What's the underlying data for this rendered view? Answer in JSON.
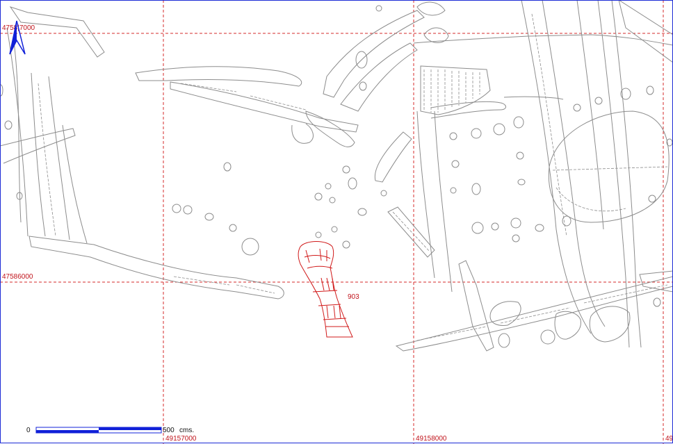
{
  "colors": {
    "grid": "#d42a2a",
    "features": "#8c8c8c",
    "selected_feature": "#d01818",
    "frame": "#1c2bd6",
    "scale_bar": "#1020d8",
    "north_arrow": "#1020d8"
  },
  "grid_labels": {
    "northing_top": "4758|7000",
    "northing_mid": "47586000",
    "easting_left": "49157000",
    "easting_right": "49158000",
    "easting_edge": "49"
  },
  "feature": {
    "label": "903"
  },
  "scale": {
    "start": "0",
    "end": "500",
    "unit": "cms."
  },
  "icons": {
    "north": "north-arrow-icon"
  }
}
